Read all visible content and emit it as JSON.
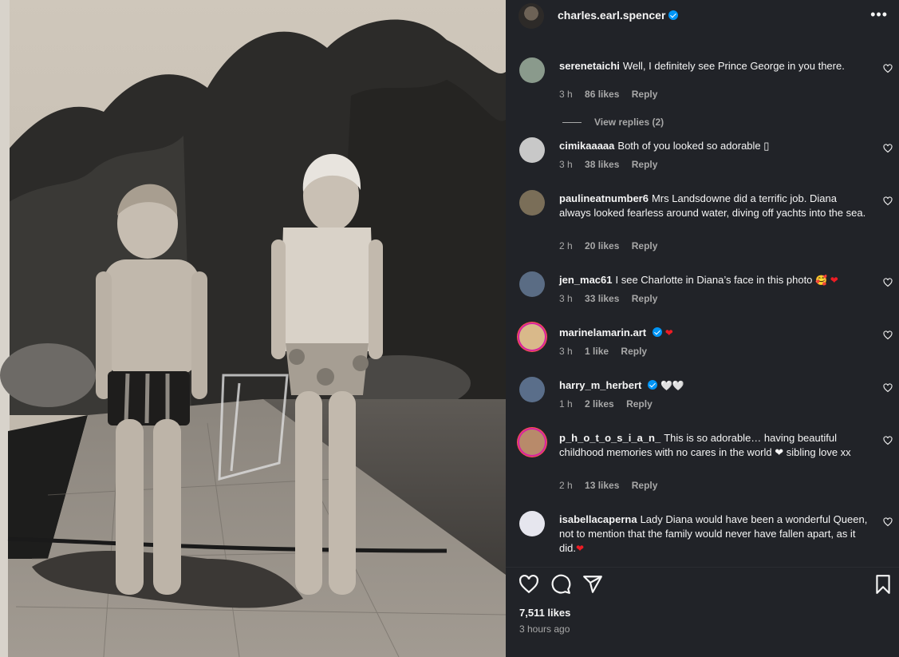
{
  "post": {
    "username": "charles.earl.spencer",
    "verified": true,
    "more_icon": "•••",
    "likes": "7,511 likes",
    "time_ago": "3 hours ago"
  },
  "comments": [
    {
      "user": "serenetaichi",
      "text": "Well, I definitely see Prince George in you there.",
      "time": "3 h",
      "likes": "86 likes",
      "reply": "Reply",
      "avatar_color": "#8a9a8c"
    },
    {
      "user": "cimikaaaaa",
      "text": "Both of you looked so adorable ▯",
      "time": "3 h",
      "likes": "38 likes",
      "reply": "Reply",
      "avatar_color": "#c8c8c8"
    },
    {
      "user": "paulineatnumber6",
      "text": "Mrs Landsdowne did a terrific job. Diana always looked fearless around water, diving off yachts into the sea.",
      "time": "2 h",
      "likes": "20 likes",
      "reply": "Reply",
      "avatar_color": "#7a6e58"
    },
    {
      "user": "jen_mac61",
      "text": "I see Charlotte in Diana’s face in this photo",
      "emoji": "🥰 ❤",
      "time": "3 h",
      "likes": "33 likes",
      "reply": "Reply",
      "avatar_color": "#5a6c84"
    },
    {
      "user": "marinelamarin.art",
      "text": "",
      "emoji": "❤",
      "time": "3 h",
      "likes": "1 like",
      "reply": "Reply",
      "avatar_color": "#d9b98a",
      "verified": true
    },
    {
      "user": "harry_m_herbert",
      "text": "",
      "emoji": "🤍🤍",
      "time": "1 h",
      "likes": "2 likes",
      "reply": "Reply",
      "avatar_color": "#5a6e8a",
      "verified": true
    },
    {
      "user": "p_h_o_t_o_s_i_a_n_",
      "text": "This is so adorable… having beautiful childhood memories with no cares in the world ❤ sibling love xx",
      "time": "2 h",
      "likes": "13 likes",
      "reply": "Reply",
      "avatar_color": "#b88a6a"
    },
    {
      "user": "isabellacaperna",
      "text": "Lady Diana would have been a wonderful Queen, not to mention that the family would never have fallen apart, as it did.",
      "emoji": "❤",
      "time": "",
      "likes": "",
      "reply": "",
      "avatar_color": "#e6e6ee"
    }
  ],
  "view_replies": "View replies (2)",
  "icons": {
    "heart": "heart-icon",
    "comment": "comment-icon",
    "share": "share-icon",
    "bookmark": "bookmark-icon"
  },
  "colors": {
    "panel_bg": "#212328",
    "verified": "#0095f6",
    "muted_text": "#a8a8a8"
  }
}
